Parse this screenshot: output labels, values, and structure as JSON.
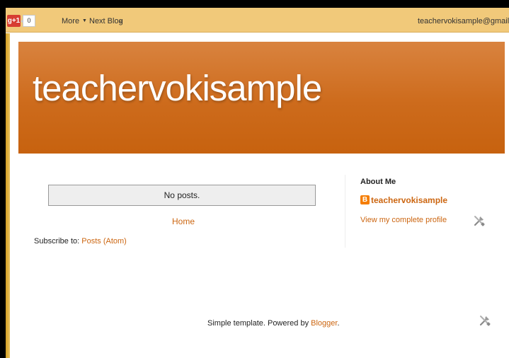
{
  "navbar": {
    "gplus_label": "g+1",
    "gplus_count": "0",
    "more_label": "More",
    "more_caret": "▼",
    "next_blog_label": "Next Blog",
    "next_blog_arrow": "»",
    "email": "teachervokisample@gmail.com"
  },
  "header": {
    "title": "teachervokisample"
  },
  "main": {
    "no_posts": "No posts.",
    "home_link": "Home",
    "subscribe_prefix": "Subscribe to:",
    "subscribe_link": "Posts (Atom)"
  },
  "sidebar": {
    "about_heading": "About Me",
    "blogger_icon_letter": "B",
    "profile_name": "teachervokisample",
    "profile_link": "View my complete profile"
  },
  "footer": {
    "text": "Simple template. Powered by",
    "link": "Blogger",
    "period": "."
  },
  "colors": {
    "accent_link": "#cc6611",
    "header_orange": "#cd6b1c",
    "navbar_bg": "#f1c97a",
    "blogger_orange": "#f57d00"
  },
  "icons": [
    "gplus-icon",
    "blogger-icon",
    "tools-icon"
  ]
}
